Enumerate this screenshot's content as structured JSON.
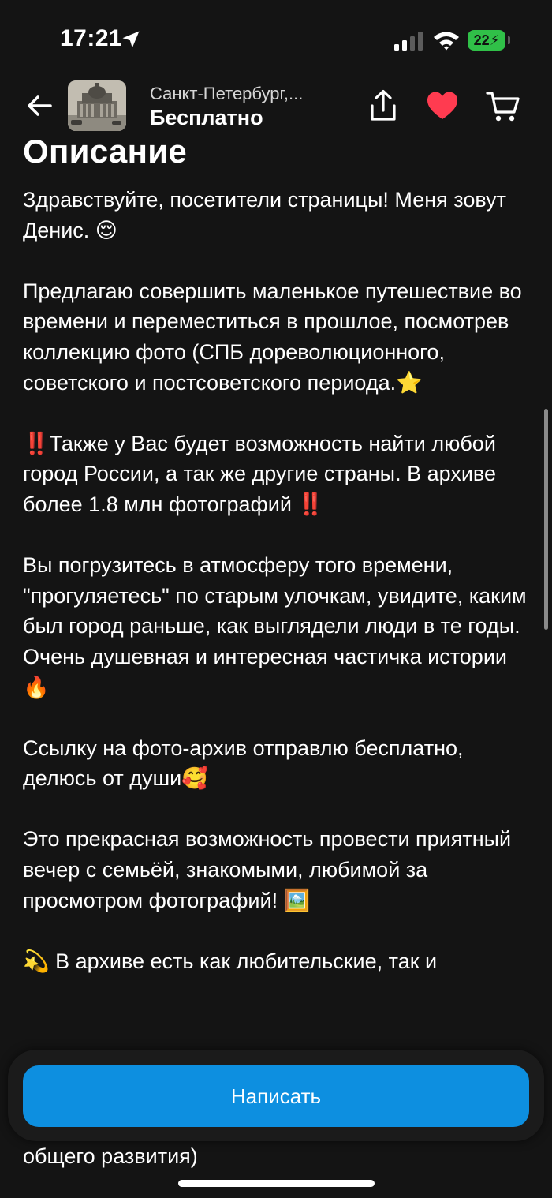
{
  "status": {
    "time": "17:21",
    "battery": "22"
  },
  "header": {
    "location": "Санкт-Петербург,...",
    "price": "Бесплатно",
    "icons": [
      "back-arrow-icon",
      "share-icon",
      "heart-icon",
      "cart-icon"
    ],
    "heart_color": "#ff3b50"
  },
  "description": {
    "title": "Описание",
    "paragraphs": [
      "Здравствуйте, посетители страницы! Меня зовут Денис. 😌",
      "Предлагаю совершить маленькое путешествие во времени и переместиться в прошлое, посмотрев коллекцию фото (СПБ дореволюционного, советского и постсоветского периода.⭐",
      "‼️Также у Вас будет возможность найти любой город России, а так же другие страны. В архиве более 1.8 млн фотографий ‼️",
      "Вы погрузитесь в атмосферу того времени, \"прогуляетесь\" по старым улочкам, увидите, каким был город раньше, как выглядели люди в те годы.\nОчень душевная и интересная частичка истории 🔥",
      "Ссылку на фото-архив отправлю бесплатно, делюсь от души🥰",
      "Это прекрасная возможность провести приятный вечер с семьёй, знакомыми, любимой за просмотром фотографий! 🖼️",
      "💫 В архиве есть как любительские, так и"
    ],
    "tail": "общего развития)"
  },
  "action": {
    "write_label": "Написать",
    "accent": "#0d8fe0"
  }
}
